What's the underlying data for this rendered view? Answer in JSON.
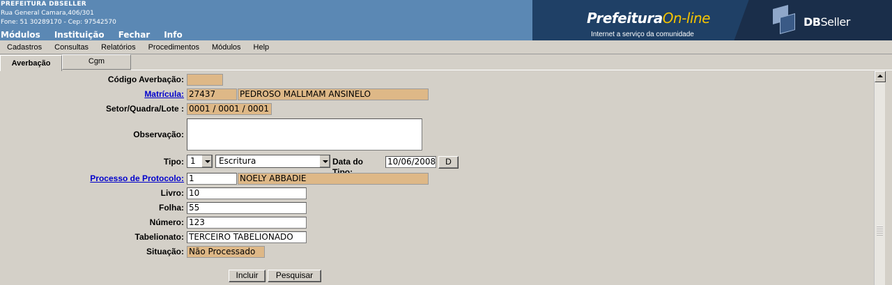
{
  "header": {
    "org_name": "PREFEITURA DBSELLER",
    "address": "Rua General Camara,406/301",
    "phone": "Fone: 51 30289170  -  Cep: 97542570",
    "menu": [
      "Módulos",
      "Instituição",
      "Fechar",
      "Info"
    ],
    "brand_name": "Prefeitura",
    "brand_online": "On-line",
    "brand_tagline": "Internet a serviço da comunidade",
    "company_bold": "DB",
    "company_rest": "Seller"
  },
  "menubar": [
    "Cadastros",
    "Consultas",
    "Relatórios",
    "Procedimentos",
    "Módulos",
    "Help"
  ],
  "tabs": [
    "Averbação",
    "Cgm"
  ],
  "form": {
    "codigo_label": "Código Averbação:",
    "codigo_value": "",
    "matricula_label": "Matrícula:",
    "matricula_value": "27437",
    "matricula_name": "PEDROSO MALLMAM ANSINELO",
    "setor_label": "Setor/Quadra/Lote :",
    "setor_value": "0001 / 0001 / 0001",
    "observacao_label": "Observação:",
    "observacao_value": "",
    "tipo_label": "Tipo:",
    "tipo_code": "1",
    "tipo_desc": "Escritura",
    "data_tipo_label": "Data do Tipo:",
    "data_tipo_value": "10/06/2008",
    "data_btn": "D",
    "processo_label": "Processo de Protocolo:",
    "processo_value": "1",
    "processo_name": "NOELY ABBADIE",
    "livro_label": "Livro:",
    "livro_value": "10",
    "folha_label": "Folha:",
    "folha_value": "55",
    "numero_label": "Número:",
    "numero_value": "123",
    "tabelionato_label": "Tabelionato:",
    "tabelionato_value": "TERCEIRO TABELIONADO",
    "situacao_label": "Situação:",
    "situacao_value": "Não Processado",
    "incluir_btn": "Incluir",
    "pesquisar_btn": "Pesquisar"
  },
  "colors": {
    "header_bg": "#5b88b4",
    "readonly_field": "#deb887",
    "link": "#0000cc"
  }
}
